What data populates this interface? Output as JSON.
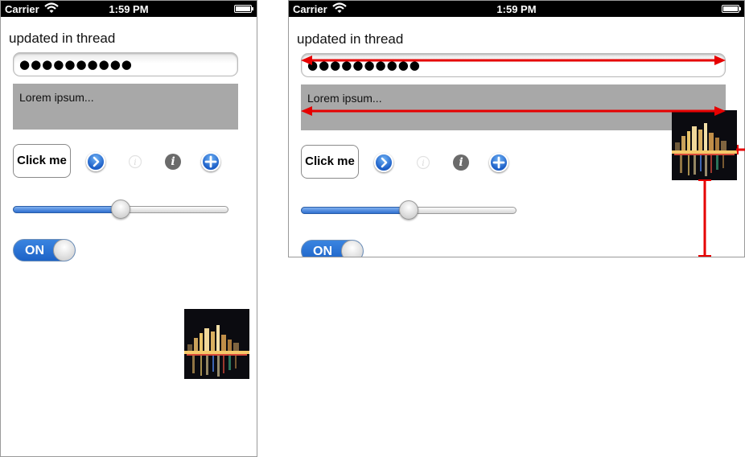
{
  "status_bar": {
    "carrier": "Carrier",
    "time": "1:59 PM"
  },
  "content": {
    "label": "updated in thread",
    "password_value": "●●●●●●●●●●",
    "text_view": "Lorem ipsum...",
    "button_label": "Click me",
    "slider_value": 0.5,
    "switch_label": "ON",
    "switch_on": true
  },
  "colors": {
    "accent": "#1d63c7",
    "text_view_bg": "#a8a8a8",
    "annotation": "#e60000"
  }
}
